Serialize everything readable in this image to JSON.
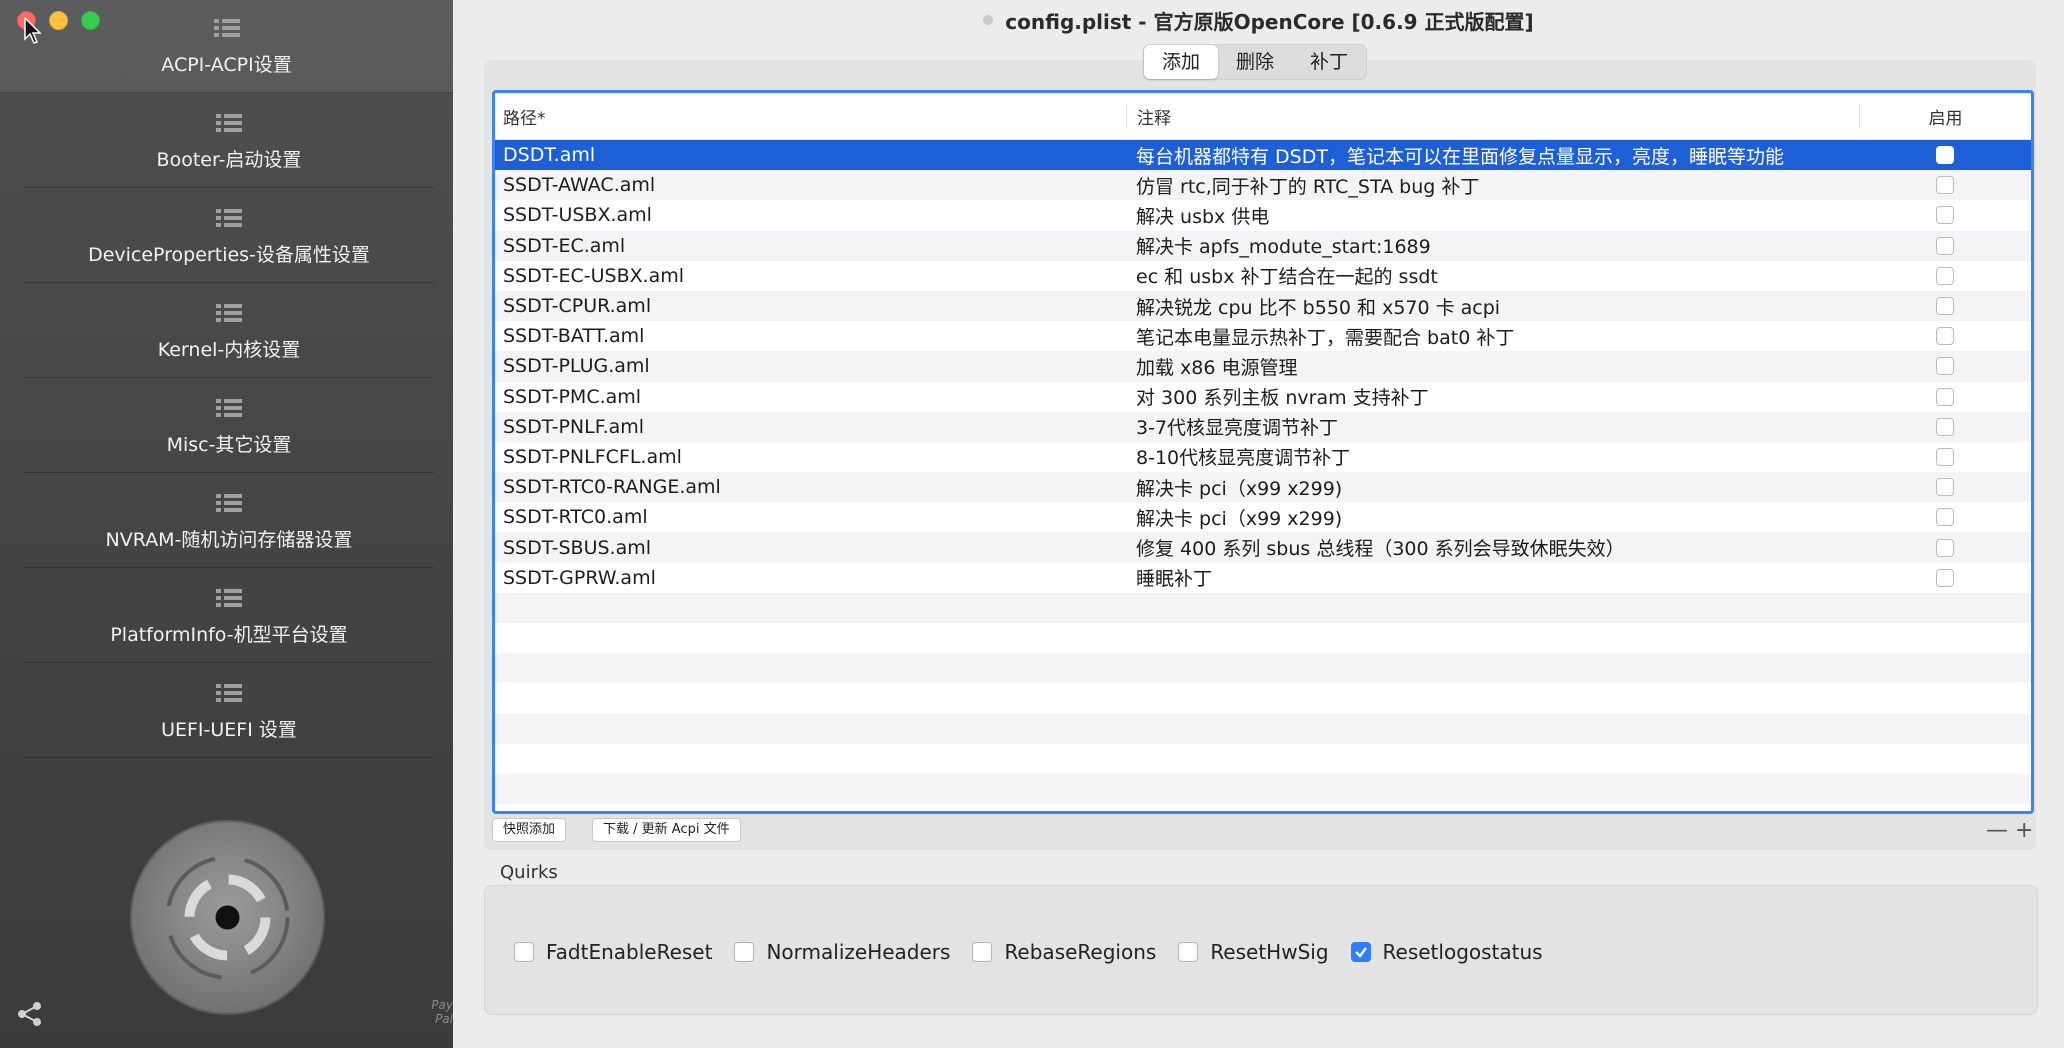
{
  "window": {
    "title": "config.plist - 官方原版OpenCore [0.6.9 正式版配置]"
  },
  "sidebar": {
    "items": [
      {
        "label": "ACPI-ACPI设置",
        "icon": "list-icon",
        "active": true
      },
      {
        "label": "Booter-启动设置",
        "icon": "list-icon"
      },
      {
        "label": "DeviceProperties-设备属性设置",
        "icon": "list-icon"
      },
      {
        "label": "Kernel-内核设置",
        "icon": "list-icon"
      },
      {
        "label": "Misc-其它设置",
        "icon": "list-icon"
      },
      {
        "label": "NVRAM-随机访问存储器设置",
        "icon": "list-icon"
      },
      {
        "label": "PlatformInfo-机型平台设置",
        "icon": "list-icon"
      },
      {
        "label": "UEFI-UEFI 设置",
        "icon": "list-icon"
      }
    ],
    "paypal": "Pay Pal"
  },
  "tabs": [
    {
      "label": "添加",
      "selected": true
    },
    {
      "label": "删除"
    },
    {
      "label": "补丁"
    }
  ],
  "table": {
    "headers": {
      "path": "路径*",
      "note": "注释",
      "enabled": "启用"
    },
    "rows": [
      {
        "path": "DSDT.aml",
        "note": "每台机器都特有 DSDT，笔记本可以在里面修复点量显示，亮度，睡眠等功能",
        "enabled": false,
        "selected": true
      },
      {
        "path": "SSDT-AWAC.aml",
        "note": "仿冒 rtc,同于补丁的 RTC_STA bug 补丁",
        "enabled": false
      },
      {
        "path": "SSDT-USBX.aml",
        "note": "解决 usbx 供电",
        "enabled": false
      },
      {
        "path": "SSDT-EC.aml",
        "note": "解决卡 apfs_modute_start:1689",
        "enabled": false
      },
      {
        "path": "SSDT-EC-USBX.aml",
        "note": "ec 和 usbx 补丁结合在一起的 ssdt",
        "enabled": false
      },
      {
        "path": "SSDT-CPUR.aml",
        "note": "解决锐龙 cpu 比不 b550 和 x570 卡 acpi",
        "enabled": false
      },
      {
        "path": "SSDT-BATT.aml",
        "note": "笔记本电量显示热补丁，需要配合 bat0 补丁",
        "enabled": false
      },
      {
        "path": "SSDT-PLUG.aml",
        "note": "加载 x86 电源管理",
        "enabled": false
      },
      {
        "path": "SSDT-PMC.aml",
        "note": "对 300 系列主板 nvram 支持补丁",
        "enabled": false
      },
      {
        "path": "SSDT-PNLF.aml",
        "note": "3-7代核显亮度调节补丁",
        "enabled": false
      },
      {
        "path": "SSDT-PNLFCFL.aml",
        "note": "8-10代核显亮度调节补丁",
        "enabled": false
      },
      {
        "path": "SSDT-RTC0-RANGE.aml",
        "note": "解决卡 pci（x99 x299)",
        "enabled": false
      },
      {
        "path": "SSDT-RTC0.aml",
        "note": "解决卡 pci（x99 x299)",
        "enabled": false
      },
      {
        "path": "SSDT-SBUS.aml",
        "note": "修复 400 系列 sbus 总线程（300 系列会导致休眠失效）",
        "enabled": false
      },
      {
        "path": "SSDT-GPRW.aml",
        "note": "睡眠补丁",
        "enabled": false
      }
    ]
  },
  "buttons": {
    "quick_add": "快照添加",
    "download": "下载 / 更新 Acpi 文件",
    "minus": "—",
    "plus": "+"
  },
  "quirks": {
    "label": "Quirks",
    "items": [
      {
        "label": "FadtEnableReset",
        "checked": false
      },
      {
        "label": "NormalizeHeaders",
        "checked": false
      },
      {
        "label": "RebaseRegions",
        "checked": false
      },
      {
        "label": "ResetHwSig",
        "checked": false
      },
      {
        "label": "Resetlogostatus",
        "checked": true
      }
    ]
  },
  "colors": {
    "accent": "#1f5fd6",
    "sidebar": "#444547"
  }
}
